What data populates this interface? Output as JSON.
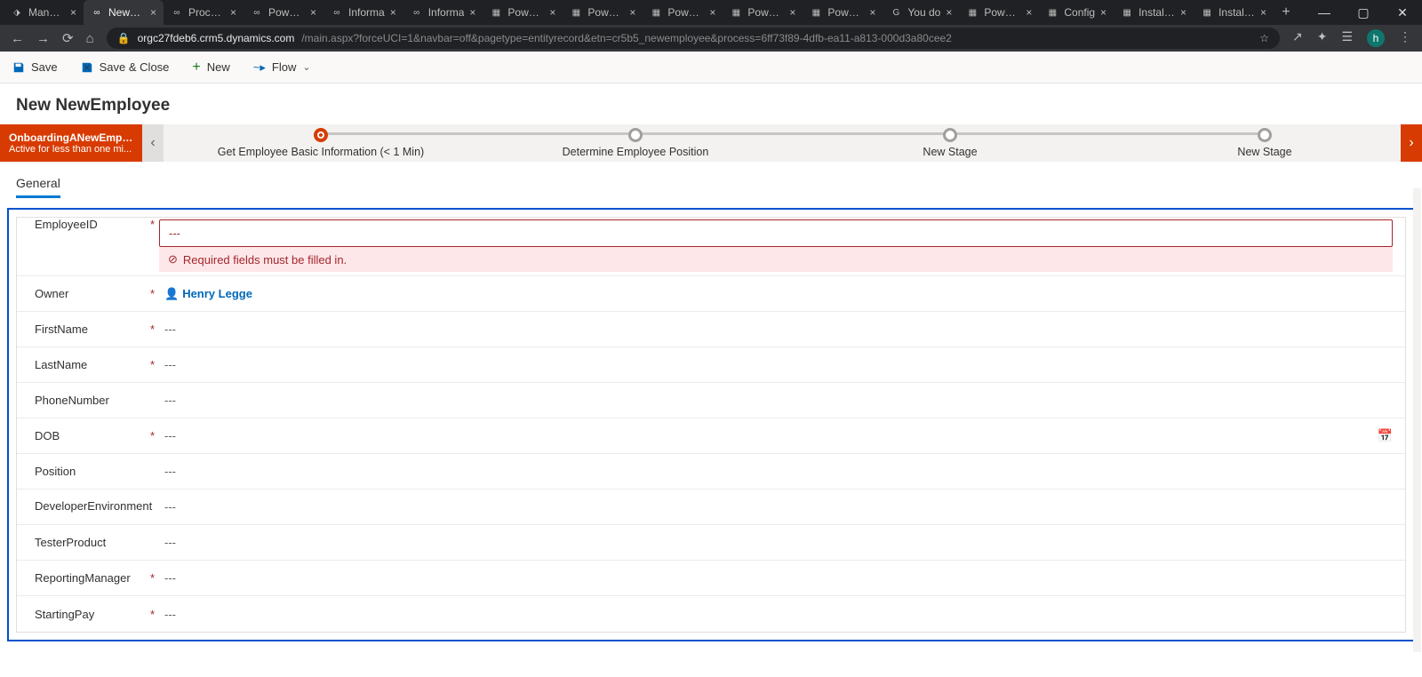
{
  "browser": {
    "tabs": [
      {
        "label": "Manage",
        "icon": "⬗",
        "active": false
      },
      {
        "label": "NewEm",
        "icon": "∞",
        "active": true
      },
      {
        "label": "Process",
        "icon": "∞",
        "active": false
      },
      {
        "label": "Power A",
        "icon": "∞",
        "active": false
      },
      {
        "label": "Informa",
        "icon": "∞",
        "active": false
      },
      {
        "label": "Informa",
        "icon": "∞",
        "active": false
      },
      {
        "label": "Power F",
        "icon": "▦",
        "active": false
      },
      {
        "label": "Power F",
        "icon": "▦",
        "active": false
      },
      {
        "label": "Power F",
        "icon": "▦",
        "active": false
      },
      {
        "label": "Power F",
        "icon": "▦",
        "active": false
      },
      {
        "label": "Power F",
        "icon": "▦",
        "active": false
      },
      {
        "label": "You do",
        "icon": "G",
        "active": false
      },
      {
        "label": "Power F",
        "icon": "▦",
        "active": false
      },
      {
        "label": "Config",
        "icon": "▦",
        "active": false
      },
      {
        "label": "Install a",
        "icon": "▦",
        "active": false
      },
      {
        "label": "Install a",
        "icon": "▦",
        "active": false
      }
    ],
    "url_host": "orgc27fdeb6.crm5.dynamics.com",
    "url_path": "/main.aspx?forceUCI=1&navbar=off&pagetype=entityrecord&etn=cr5b5_newemployee&process=6ff73f89-4dfb-ea11-a813-000d3a80cee2",
    "avatar": "h"
  },
  "commands": {
    "save": "Save",
    "save_close": "Save & Close",
    "new": "New",
    "flow": "Flow"
  },
  "record_title": "New NewEmployee",
  "bpf": {
    "name": "OnboardingANewEmplo...",
    "subtitle": "Active for less than one mi...",
    "stages": [
      {
        "label": "Get Employee Basic Information  (< 1 Min)",
        "active": true
      },
      {
        "label": "Determine Employee Position",
        "active": false
      },
      {
        "label": "New Stage",
        "active": false
      },
      {
        "label": "New Stage",
        "active": false
      }
    ]
  },
  "form": {
    "tab": "General",
    "error_text": "Required fields must be filled in.",
    "owner": "Henry Legge",
    "placeholder": "---",
    "fields": {
      "employee_id": {
        "label": "EmployeeID",
        "required": true,
        "value": "---"
      },
      "owner": {
        "label": "Owner",
        "required": true
      },
      "first_name": {
        "label": "FirstName",
        "required": true,
        "value": "---"
      },
      "last_name": {
        "label": "LastName",
        "required": true,
        "value": "---"
      },
      "phone": {
        "label": "PhoneNumber",
        "required": false,
        "value": "---"
      },
      "dob": {
        "label": "DOB",
        "required": true,
        "value": "---"
      },
      "position": {
        "label": "Position",
        "required": false,
        "value": "---"
      },
      "dev_env": {
        "label": "DeveloperEnvironment",
        "required": false,
        "value": "---"
      },
      "tester": {
        "label": "TesterProduct",
        "required": false,
        "value": "---"
      },
      "manager": {
        "label": "ReportingManager",
        "required": true,
        "value": "---"
      },
      "pay": {
        "label": "StartingPay",
        "required": true,
        "value": "---"
      }
    }
  }
}
